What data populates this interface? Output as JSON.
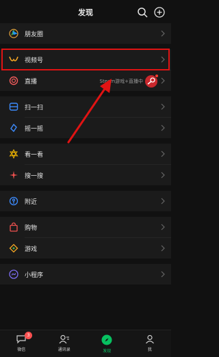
{
  "header": {
    "title": "发现"
  },
  "menu": {
    "groups": [
      {
        "items": [
          {
            "label": "朋友圈",
            "icon": "moments-icon"
          }
        ]
      },
      {
        "items": [
          {
            "label": "视频号",
            "icon": "channels-icon"
          },
          {
            "label": "直播",
            "icon": "live-icon",
            "extra_text": "Steam游戏+直播中"
          }
        ]
      },
      {
        "items": [
          {
            "label": "扫一扫",
            "icon": "scan-icon"
          },
          {
            "label": "摇一摇",
            "icon": "shake-icon"
          }
        ]
      },
      {
        "items": [
          {
            "label": "看一看",
            "icon": "top-stories-icon"
          },
          {
            "label": "搜一搜",
            "icon": "search-icon"
          }
        ]
      },
      {
        "items": [
          {
            "label": "附近",
            "icon": "nearby-icon"
          }
        ]
      },
      {
        "items": [
          {
            "label": "购物",
            "icon": "shopping-icon"
          },
          {
            "label": "游戏",
            "icon": "games-icon"
          }
        ]
      },
      {
        "items": [
          {
            "label": "小程序",
            "icon": "mini-programs-icon"
          }
        ]
      }
    ]
  },
  "tabbar": {
    "tabs": [
      {
        "label": "微信",
        "badge": "3"
      },
      {
        "label": "通讯录"
      },
      {
        "label": "发现"
      },
      {
        "label": "我"
      }
    ]
  },
  "colors": {
    "accent": "#07c160",
    "highlight": "#e01313",
    "badge": "#fa5151"
  }
}
